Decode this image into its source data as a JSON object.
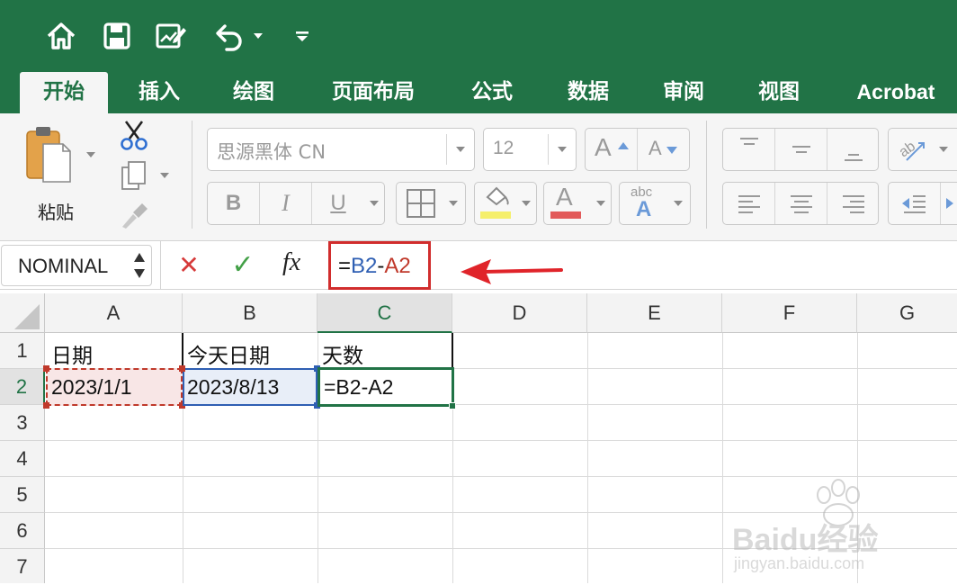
{
  "quick_access": {
    "icons": [
      "home-icon",
      "save-icon",
      "edit-icon",
      "undo-icon",
      "customize-icon"
    ]
  },
  "tabs": [
    {
      "label": "开始",
      "active": true
    },
    {
      "label": "插入"
    },
    {
      "label": "绘图"
    },
    {
      "label": "页面布局"
    },
    {
      "label": "公式"
    },
    {
      "label": "数据"
    },
    {
      "label": "审阅"
    },
    {
      "label": "视图"
    },
    {
      "label": "Acrobat"
    }
  ],
  "ribbon": {
    "paste_label": "粘贴",
    "font_name": "思源黑体 CN",
    "font_size": "12",
    "bold": "B",
    "italic": "I",
    "underline": "U",
    "font_color_letter": "A",
    "grow_letter": "A",
    "shrink_letter": "A",
    "abc_label": "abc",
    "highlight_color": "#f5ef6b",
    "font_color": "#e25a5a"
  },
  "formula_bar": {
    "name_box": "NOMINAL",
    "cancel_symbol": "✕",
    "enter_symbol": "✓",
    "fx_label": "fx",
    "formula_parts": [
      {
        "text": "=",
        "color": "#111111"
      },
      {
        "text": "B2",
        "color": "#2f5fb3"
      },
      {
        "text": "-",
        "color": "#111111"
      },
      {
        "text": "A2",
        "color": "#c0392b"
      }
    ]
  },
  "sheet": {
    "columns": [
      "A",
      "B",
      "C",
      "D",
      "E",
      "F",
      "G"
    ],
    "selected_column": "C",
    "rows": [
      "1",
      "2",
      "3",
      "4",
      "5",
      "6",
      "7"
    ],
    "selected_row": "2",
    "cells": {
      "A1": "日期",
      "B1": "今天日期",
      "C1": "天数",
      "A2": "2023/1/1",
      "B2": "2023/8/13",
      "C2": "=B2-A2"
    }
  },
  "colors": {
    "title_bar": "#217346",
    "highlight_box": "#d12d2d",
    "ref_a2": "#c0392b",
    "ref_b2": "#2f5fb3",
    "active_cell": "#217346"
  },
  "watermark": {
    "brand": "Baidu经验",
    "url": "jingyan.baidu.com"
  }
}
